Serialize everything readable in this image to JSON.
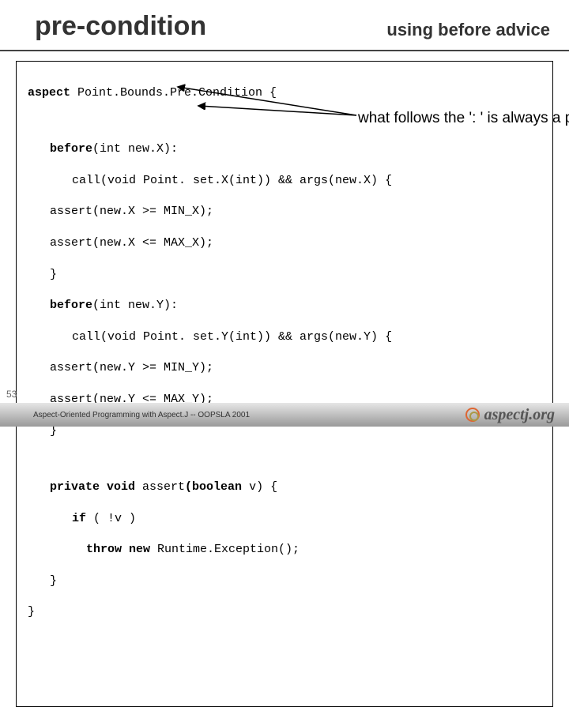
{
  "header": {
    "title": "pre-condition",
    "subtitle": "using before advice"
  },
  "code": {
    "line_aspect_kw": "aspect",
    "line_aspect_rest": " Point.Bounds.Pre.Condition {",
    "before1_sig_kw": "before",
    "before1_sig_rest": "(int new.X):",
    "before1_pc_a": "call(void Point. set.X(int)) && args(new.X) {",
    "before1_b1": "assert(new.X >= MIN_X);",
    "before1_b2": "assert(new.X <= MAX_X);",
    "before1_close": "}",
    "before2_sig_kw": "before",
    "before2_sig_rest": "(int new.Y):",
    "before2_pc_a": "call(void Point. set.Y(int)) && args(new.Y) {",
    "before2_b1": "assert(new.Y >= MIN_Y);",
    "before2_b2": "assert(new.Y <= MAX_Y);",
    "before2_close": "}",
    "assert_sig_kw1": "private void",
    "assert_sig_mid": " assert",
    "assert_sig_kw2": "(boolean",
    "assert_sig_rest": " v) {",
    "assert_if_kw": "if",
    "assert_if_rest": " ( !v )",
    "assert_throw_kw": "throw new",
    "assert_throw_rest": " Runtime.Exception();",
    "assert_close": "}",
    "aspect_close": "}"
  },
  "annotation": {
    "text": "what follows the ': ' is always a pointcut – primitive or user-defined"
  },
  "footer": {
    "slide_number": "53",
    "caption": "Aspect-Oriented Programming with Aspect.J -- OOPSLA 2001",
    "logo_text": "aspectj.org"
  }
}
